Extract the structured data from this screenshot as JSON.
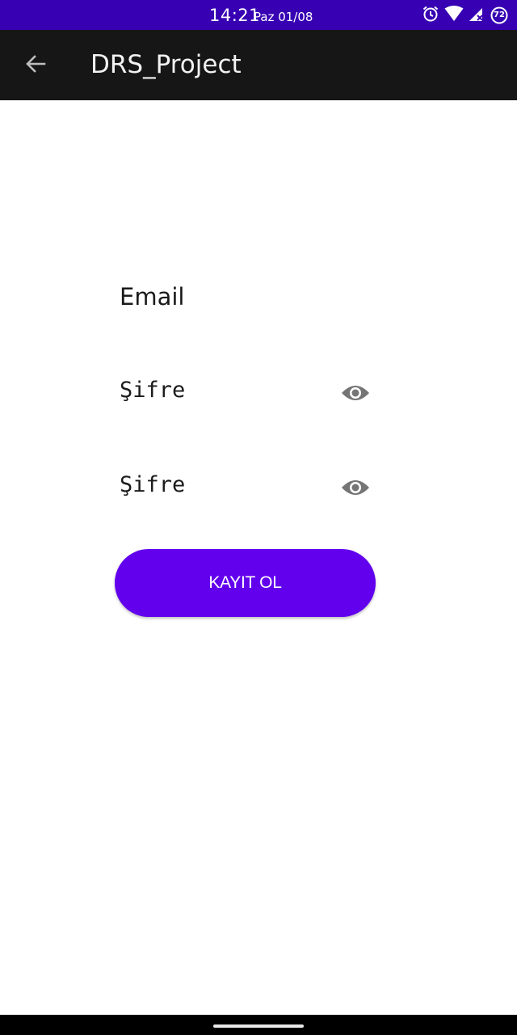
{
  "status_bar": {
    "time": "14:21",
    "date": "Paz 01/08",
    "battery_level": "72",
    "icons": [
      "alarm-icon",
      "wifi-icon",
      "signal-icon",
      "battery-icon"
    ],
    "background": "#3700b3"
  },
  "app_bar": {
    "title": "DRS_Project",
    "back_icon": "arrow-back-icon",
    "background": "#161616"
  },
  "form": {
    "email_hint": "Email",
    "password_hint": "Şifre",
    "password_confirm_hint": "Şifre",
    "toggle_icon": "eye-icon",
    "submit_label": "KAYIT OL",
    "accent": "#6200ee"
  }
}
